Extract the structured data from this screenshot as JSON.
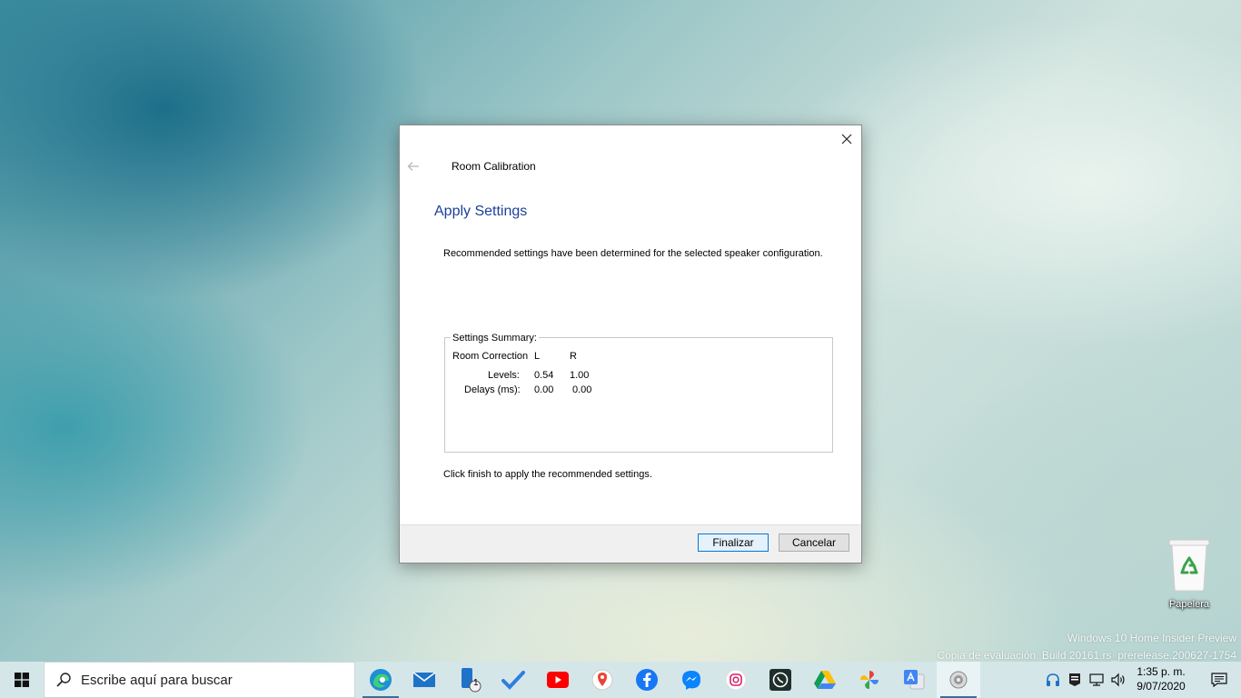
{
  "dialog": {
    "title": "Room Calibration",
    "heading": "Apply Settings",
    "description": "Recommended settings have been determined for the selected speaker configuration.",
    "summary": {
      "legend": "Settings Summary:",
      "room_correction_label": "Room Correction",
      "col_l": "L",
      "col_r": "R",
      "levels_label": "Levels:",
      "levels_l": "0.54",
      "levels_r": "1.00",
      "delays_label": "Delays (ms):",
      "delays_l": "0.00",
      "delays_r": "0.00"
    },
    "finish_note": "Click finish to apply the recommended settings.",
    "finish_button": "Finalizar",
    "cancel_button": "Cancelar"
  },
  "desktop": {
    "recycle_bin_label": "Papelera",
    "watermark_line1": "Windows 10 Home Insider Preview",
    "watermark_line2": "Copia de evaluación. Build 20161.rs_prerelease.200627-1754"
  },
  "taskbar": {
    "search_placeholder": "Escribe aquí para buscar",
    "phone_badge": "1",
    "pinned_icons": [
      "edge-icon",
      "mail-icon",
      "your-phone-icon",
      "todo-icon",
      "youtube-icon",
      "google-maps-icon",
      "facebook-icon",
      "messenger-icon",
      "instagram-icon",
      "whatsapp-icon",
      "google-drive-icon",
      "google-photos-icon",
      "google-translate-icon",
      "speaker-app-icon"
    ],
    "time": "1:35 p. m.",
    "date": "9/07/2020"
  },
  "colors": {
    "heading_blue": "#1b3f9a",
    "taskbar_bg": "#d5e6e9",
    "primary_button_border": "#0078d7"
  }
}
